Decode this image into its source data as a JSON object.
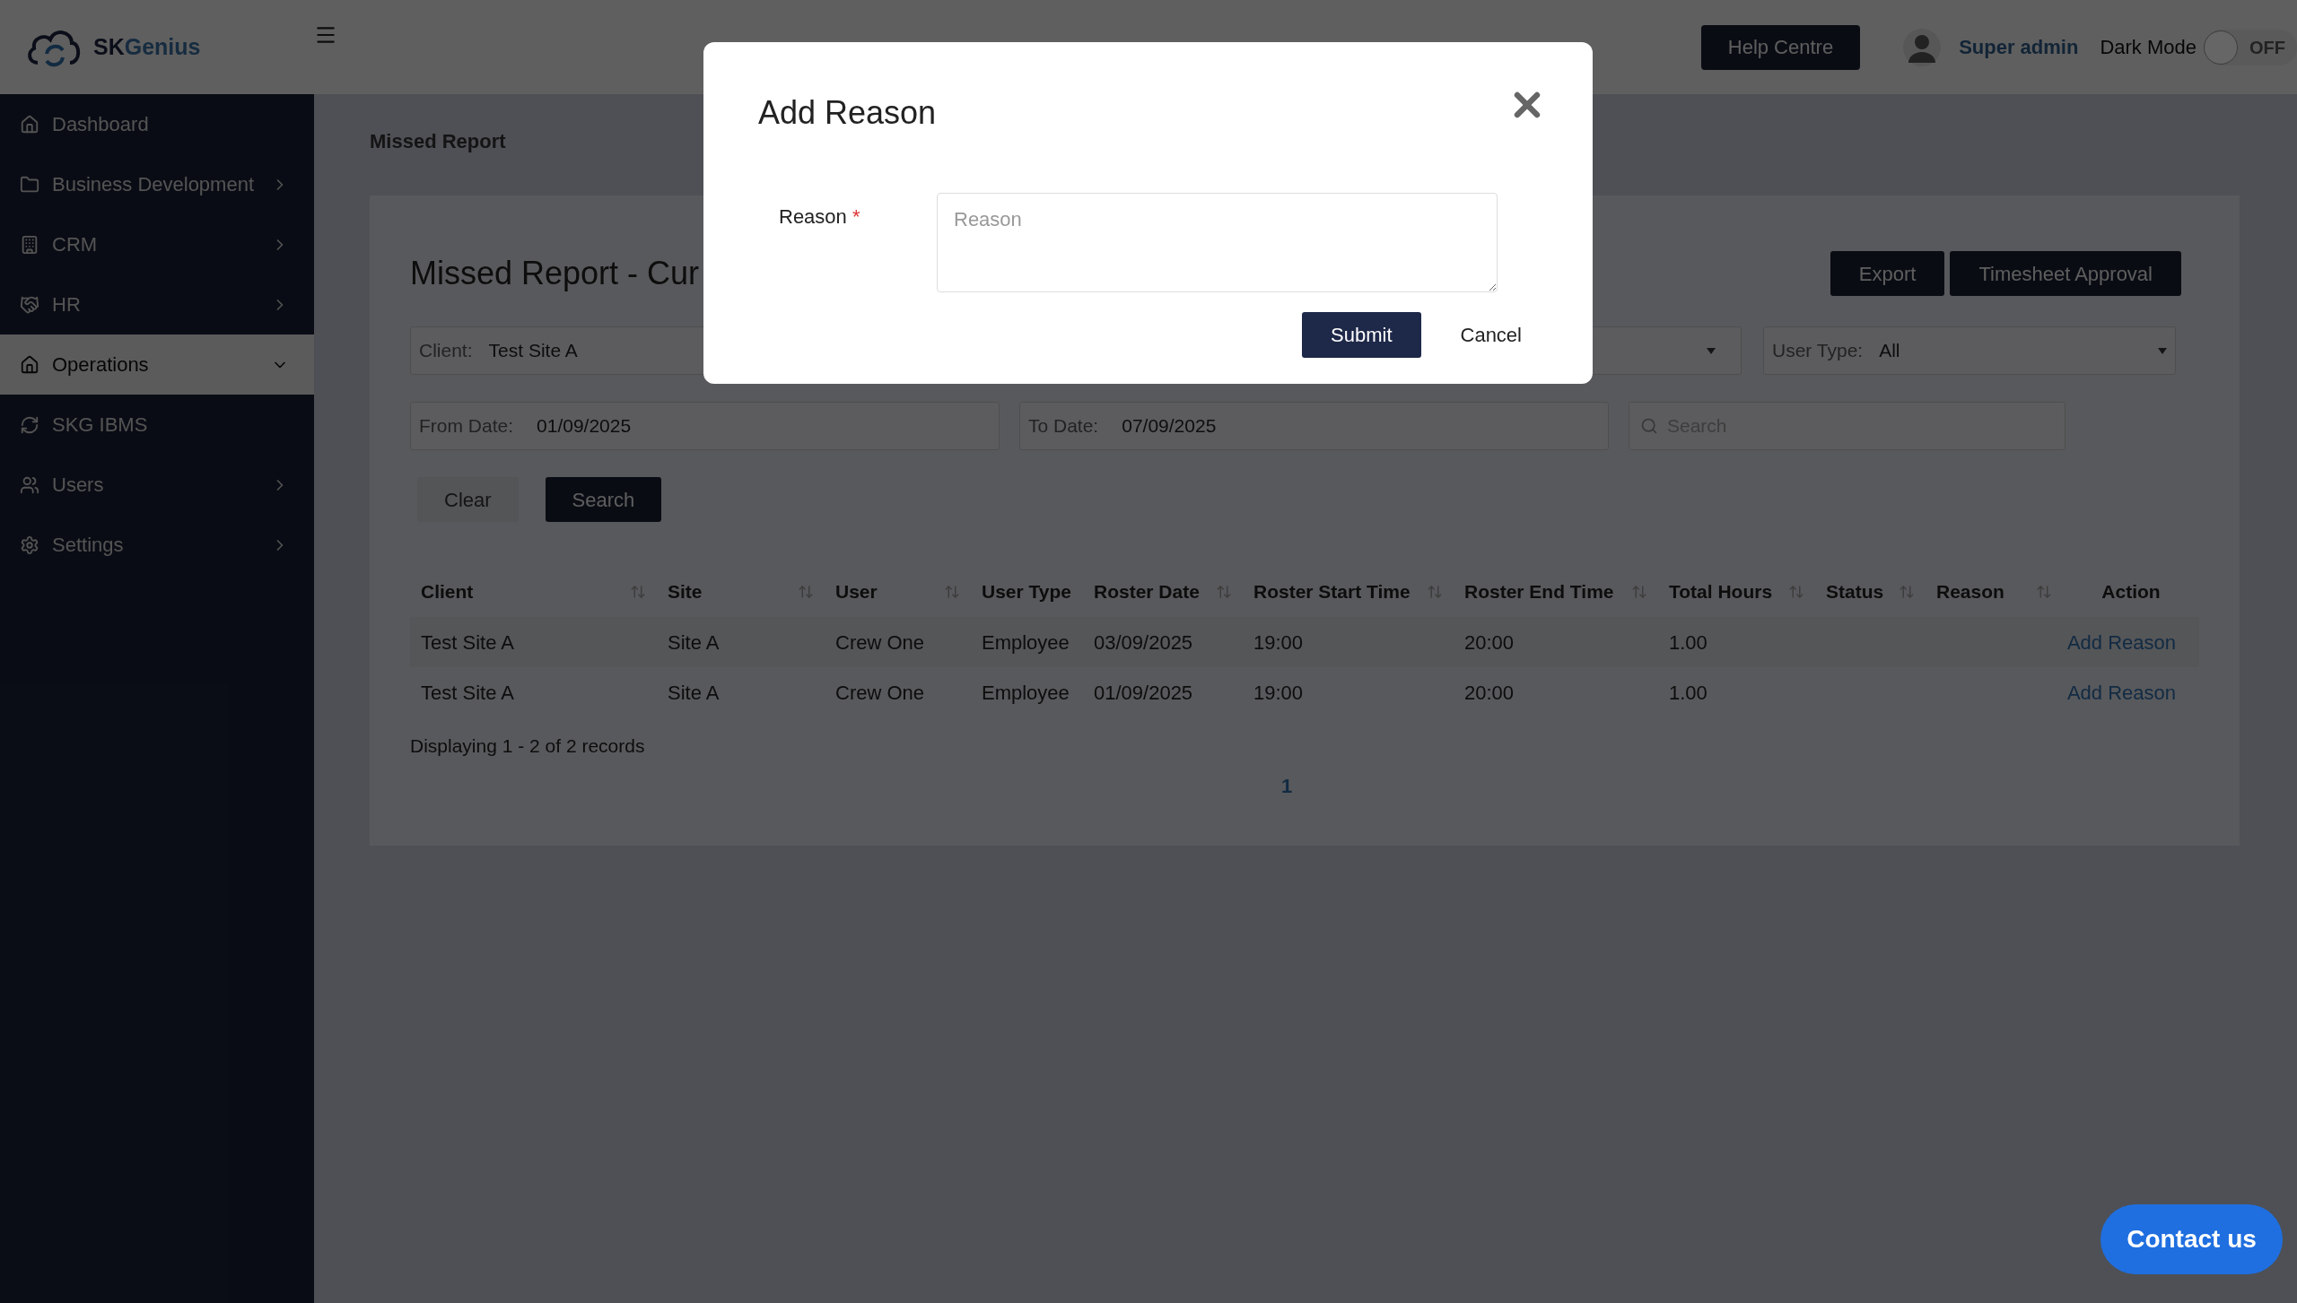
{
  "brand": {
    "name_dark": "SK",
    "name_accent": "Genius"
  },
  "header": {
    "help_button": "Help Centre",
    "user_name": "Super admin",
    "dark_mode": {
      "label": "Dark Mode",
      "on": false,
      "state_text": "OFF"
    }
  },
  "sidebar": {
    "items": [
      {
        "label": "Dashboard",
        "has_submenu": false,
        "selected": false
      },
      {
        "label": "Business Development",
        "has_submenu": true,
        "expanded": false,
        "selected": false
      },
      {
        "label": "CRM",
        "has_submenu": true,
        "expanded": false,
        "selected": false
      },
      {
        "label": "HR",
        "has_submenu": true,
        "expanded": false,
        "selected": false
      },
      {
        "label": "Operations",
        "has_submenu": true,
        "expanded": true,
        "selected": true
      },
      {
        "label": "SKG IBMS",
        "has_submenu": false,
        "selected": false
      },
      {
        "label": "Users",
        "has_submenu": true,
        "expanded": false,
        "selected": false
      },
      {
        "label": "Settings",
        "has_submenu": true,
        "expanded": false,
        "selected": false
      }
    ]
  },
  "breadcrumb": "Missed Report",
  "page_title": "Missed Report - Cur",
  "actions": [
    "Export",
    "Timesheet Approval"
  ],
  "filters": {
    "client": {
      "label": "Client:",
      "value": "Test Site A"
    },
    "user_type": {
      "label": "User Type:",
      "value": "All"
    },
    "from_date": {
      "label": "From Date:",
      "value": "01/09/2025"
    },
    "to_date": {
      "label": "To Date:",
      "value": "07/09/2025"
    },
    "search": {
      "placeholder": "Search"
    }
  },
  "filter_buttons": [
    "Clear",
    "Search"
  ],
  "table": {
    "columns": [
      {
        "label": "Client",
        "sortable": true
      },
      {
        "label": "Site",
        "sortable": true
      },
      {
        "label": "User",
        "sortable": true
      },
      {
        "label": "User Type",
        "sortable": false
      },
      {
        "label": "Roster Date",
        "sortable": true
      },
      {
        "label": "Roster Start Time",
        "sortable": true
      },
      {
        "label": "Roster End Time",
        "sortable": true
      },
      {
        "label": "Total Hours",
        "sortable": true
      },
      {
        "label": "Status",
        "sortable": true
      },
      {
        "label": "Reason",
        "sortable": true
      },
      {
        "label": "Action",
        "sortable": false
      }
    ],
    "rows": [
      {
        "cells": [
          "Test Site A",
          "Site A",
          "Crew One",
          "Employee",
          "03/09/2025",
          "19:00",
          "20:00",
          "1.00",
          "",
          ""
        ],
        "action": "Add Reason"
      },
      {
        "cells": [
          "Test Site A",
          "Site A",
          "Crew One",
          "Employee",
          "01/09/2025",
          "19:00",
          "20:00",
          "1.00",
          "",
          ""
        ],
        "action": "Add Reason"
      }
    ]
  },
  "records_text": "Displaying 1 - 2 of 2 records",
  "pagination": [
    {
      "label": "1",
      "selected": true
    }
  ],
  "modal": {
    "title": "Add Reason",
    "field_label": "Reason",
    "required_mark": "*",
    "placeholder": "Reason",
    "submit": "Submit",
    "cancel": "Cancel"
  },
  "contact_button": "Contact us"
}
